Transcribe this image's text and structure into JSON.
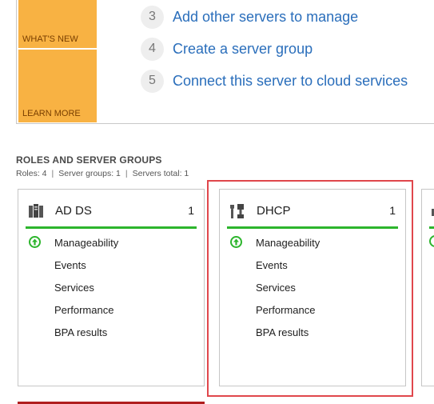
{
  "welcome": {
    "tiles": {
      "whats_new": "WHAT'S NEW",
      "learn_more": "LEARN MORE"
    },
    "steps": [
      {
        "num": "3",
        "label": "Add other servers to manage"
      },
      {
        "num": "4",
        "label": "Create a server group"
      },
      {
        "num": "5",
        "label": "Connect this server to cloud services"
      }
    ]
  },
  "roles_section": {
    "title": "ROLES AND SERVER GROUPS",
    "summary": {
      "roles": "Roles: 4",
      "server_groups": "Server groups: 1",
      "servers_total": "Servers total: 1",
      "separator": "|"
    }
  },
  "cards": [
    {
      "name": "AD DS",
      "count": "1",
      "icon": "server-stack-icon",
      "items": [
        "Manageability",
        "Events",
        "Services",
        "Performance",
        "BPA results"
      ],
      "status": "up-arrow-green"
    },
    {
      "name": "DHCP",
      "count": "1",
      "icon": "network-tool-icon",
      "items": [
        "Manageability",
        "Events",
        "Services",
        "Performance",
        "BPA results"
      ],
      "status": "up-arrow-green"
    }
  ],
  "colors": {
    "tile": "#f8b243",
    "link": "#2a6ebb",
    "status_green": "#2db52d",
    "highlight": "#e0474c",
    "critical_red": "#b01e1e"
  }
}
